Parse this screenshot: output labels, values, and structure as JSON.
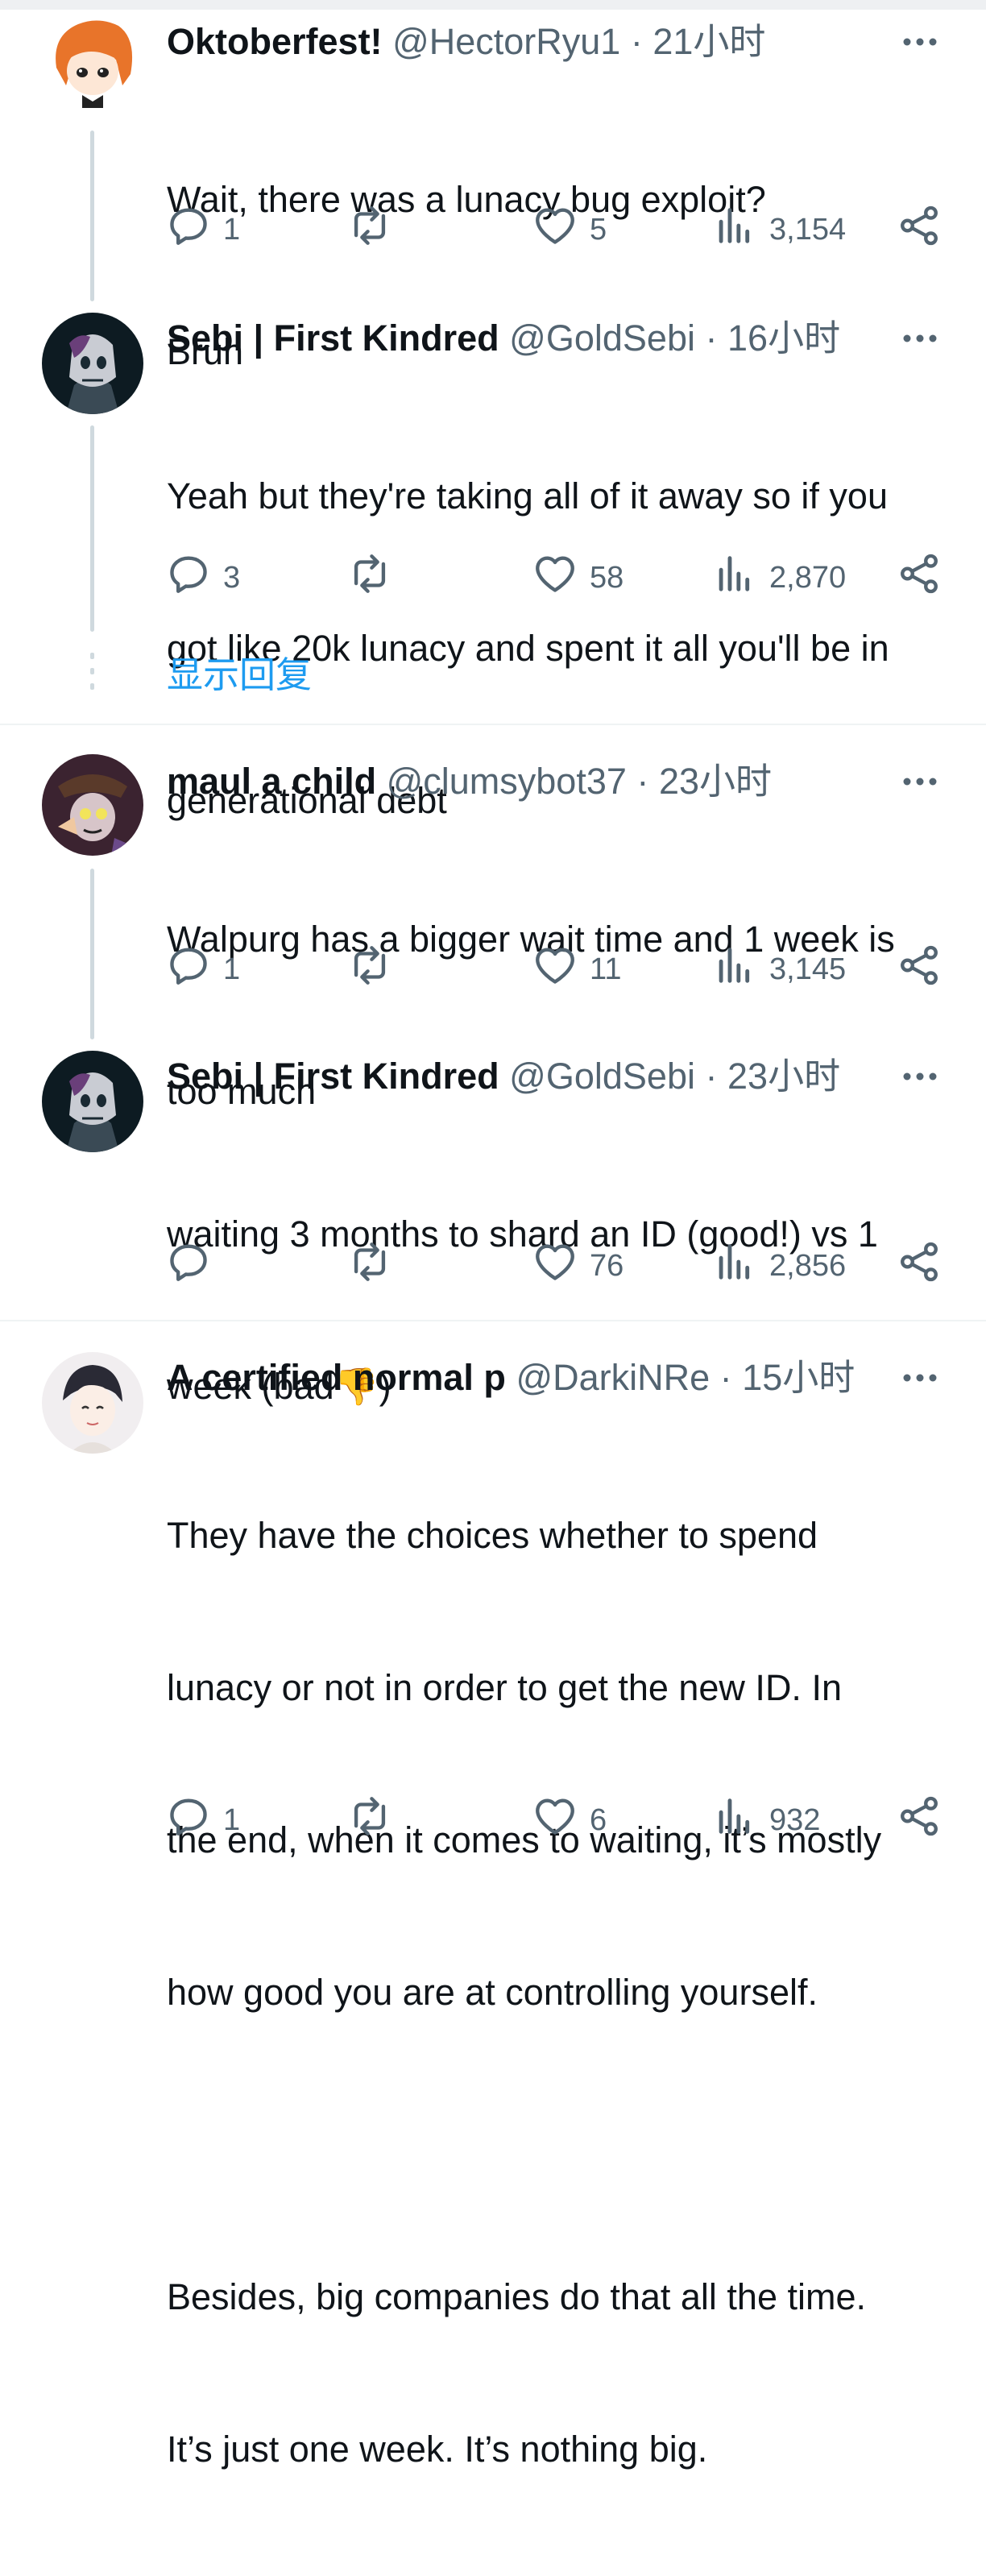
{
  "tweets": [
    {
      "name": "Oktoberfest!",
      "handle": "@HectorRyu1",
      "time": "21小时",
      "lines": [
        "Wait, there was a lunacy bug exploit?",
        "Bruh"
      ],
      "stats": {
        "replies": "1",
        "retweets": "",
        "likes": "5",
        "views": "3,154"
      }
    },
    {
      "name": "Sebi | First Kindred",
      "handle": "@GoldSebi",
      "time": "16小时",
      "lines": [
        "Yeah but they're taking all of it away so if you",
        "got like 20k lunacy and spent it all you'll be in",
        "generational debt"
      ],
      "stats": {
        "replies": "3",
        "retweets": "",
        "likes": "58",
        "views": "2,870"
      }
    },
    {
      "name": "maul a child",
      "handle": "@clumsybot37",
      "time": "23小时",
      "lines": [
        "Walpurg has a bigger wait time and 1 week is",
        "too much"
      ],
      "stats": {
        "replies": "1",
        "retweets": "",
        "likes": "11",
        "views": "3,145"
      }
    },
    {
      "name": "Sebi | First Kindred",
      "handle": "@GoldSebi",
      "time": "23小时",
      "lines": [
        "waiting 3 months to shard an ID (good!) vs 1",
        "week (bad👎)"
      ],
      "stats": {
        "replies": "",
        "retweets": "",
        "likes": "76",
        "views": "2,856"
      }
    },
    {
      "name": "A certified normal p",
      "handle": "@DarkiNRe",
      "time": "15小时",
      "lines": [
        "They have the choices whether to spend",
        "lunacy or not in order to get the new ID. In",
        "the end, when it comes to waiting, it’s mostly",
        "how good you are at controlling yourself.",
        "",
        "Besides, big companies do that all the time.",
        "It’s just one week. It’s nothing big."
      ],
      "stats": {
        "replies": "1",
        "retweets": "",
        "likes": "6",
        "views": "932"
      }
    }
  ],
  "show_replies": "显示回复",
  "dot_separator": "·",
  "colors": {
    "text": "#0f1419",
    "muted": "#536471",
    "link": "#1d9bf0",
    "line": "#cfd9de"
  },
  "icons": {
    "reply": "reply-icon",
    "retweet": "retweet-icon",
    "like": "heart-icon",
    "views": "views-icon",
    "share": "share-icon",
    "more": "more-icon"
  }
}
